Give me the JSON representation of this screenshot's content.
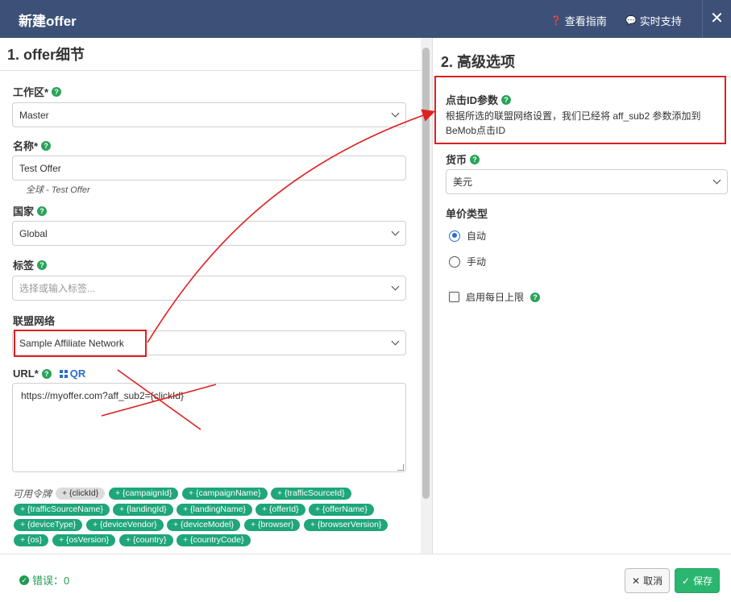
{
  "header": {
    "title": "新建offer",
    "guide_label": "查看指南",
    "support_label": "实时支持",
    "close_label": "✕"
  },
  "left": {
    "section_title": "1. offer细节",
    "workspace": {
      "label": "工作区*",
      "value": "Master"
    },
    "name": {
      "label": "名称*",
      "value": "Test Offer",
      "note": "全球 - Test Offer"
    },
    "country": {
      "label": "国家",
      "value": "Global"
    },
    "tags": {
      "label": "标签",
      "placeholder": "选择或输入标签..."
    },
    "network": {
      "label": "联盟网络",
      "value": "Sample Affiliate Network"
    },
    "url": {
      "label": "URL*",
      "qr_label": "QR",
      "value": "https://myoffer.com?aff_sub2={clickId}"
    },
    "tokens_label": "可用令牌",
    "tokens": [
      "+ {clickId}",
      "+ {campaignId}",
      "+ {campaignName}",
      "+ {trafficSourceId}",
      "+ {trafficSourceName}",
      "+ {landingId}",
      "+ {landingName}",
      "+ {offerId}",
      "+ {offerName}",
      "+ {deviceType}",
      "+ {deviceVendor}",
      "+ {deviceModel}",
      "+ {browser}",
      "+ {browserVersion}",
      "+ {os}",
      "+ {osVersion}",
      "+ {country}",
      "+ {countryCode}"
    ]
  },
  "right": {
    "section_title": "2. 高级选项",
    "clickid": {
      "label": "点击ID参数",
      "desc": "根据所选的联盟网络设置，我们已经将 aff_sub2 参数添加到BeMob点击ID"
    },
    "currency": {
      "label": "货币",
      "value": "美元"
    },
    "price_type": {
      "label": "单价类型",
      "options": [
        "自动",
        "手动"
      ],
      "selected": "自动"
    },
    "daily_cap": {
      "label": "启用每日上限",
      "checked": false
    }
  },
  "footer": {
    "errors_label": "错误：0",
    "cancel_label": "取消",
    "save_label": "保存"
  },
  "colors": {
    "header_bg": "#3d5178",
    "token_green": "#1fa67a",
    "annotation_red": "#e02020",
    "save_green": "#2bb56e",
    "accent_blue": "#2a6fc9"
  }
}
